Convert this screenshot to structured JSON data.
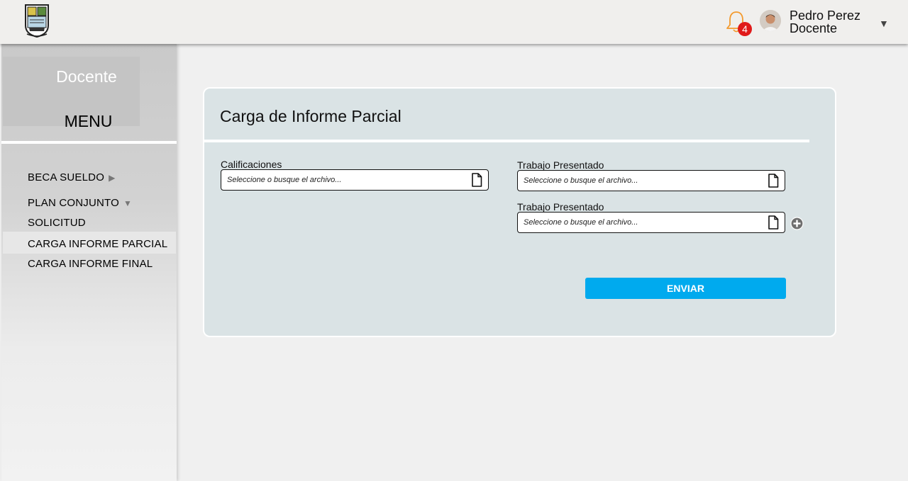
{
  "header": {
    "notifications_count": "4",
    "user_name": "Pedro Perez",
    "user_role": "Docente"
  },
  "sidebar": {
    "role": "Docente",
    "menu_title": "MENU",
    "items": [
      {
        "label": "BECA SUELDO",
        "arrow": "▶"
      },
      {
        "label": "PLAN CONJUNTO",
        "arrow": "▼"
      },
      {
        "label": "SOLICITUD"
      },
      {
        "label": "CARGA INFORME PARCIAL",
        "active": true
      },
      {
        "label": "CARGA INFORME FINAL"
      }
    ]
  },
  "form": {
    "title": "Carga de Informe Parcial",
    "fields": [
      {
        "label": "Calificaciones",
        "placeholder": "Seleccione o busque el archivo..."
      },
      {
        "label": "Trabajo Presentado",
        "placeholder": "Seleccione o busque el archivo..."
      },
      {
        "label": "Trabajo Presentado",
        "placeholder": "Seleccione o busque el archivo..."
      }
    ],
    "submit_label": "ENVIAR"
  },
  "colors": {
    "accent": "#00aaee",
    "card_background": "#dae3e5",
    "badge": "#e01a1a",
    "bell": "#f39a2e"
  },
  "icons": [
    "university-logo",
    "bell-icon",
    "avatar",
    "chevron-down-icon",
    "file-icon",
    "add-circle-icon"
  ]
}
